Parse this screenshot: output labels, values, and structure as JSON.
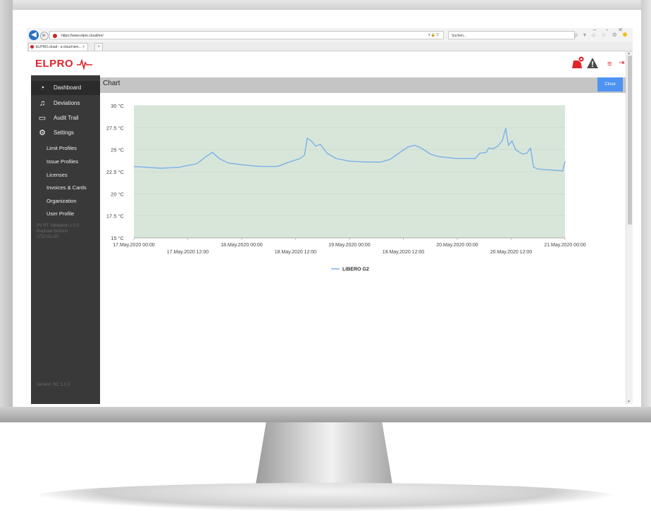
{
  "browser": {
    "url": "https://www.elpro.cloud/en/",
    "search_placeholder": "Suchen...",
    "tab_title": "ELPRO.cloud - a cloud tem...",
    "new_tab": "+",
    "window_controls": "–  ▫  ✕",
    "toolbar_icons": "ρ ▾  ⌂ ☆ ⚙",
    "addr_tools": "▾ 🔒 C"
  },
  "app": {
    "logo_text": "ELPRO",
    "brand_color": "#e0242c",
    "accent_color": "#4e93f3"
  },
  "header_icons": {
    "bell": "bell-icon",
    "warning": "warning-icon",
    "menu": "≡",
    "logout": "⇥"
  },
  "sidebar": {
    "main_items": [
      {
        "label": "Dashboard",
        "icon": "dashboard-icon",
        "glyph": "◔"
      },
      {
        "label": "Deviations",
        "icon": "bell-icon",
        "glyph": "🔔"
      },
      {
        "label": "Audit Trail",
        "icon": "audit-icon",
        "glyph": "🗎"
      },
      {
        "label": "Settings",
        "icon": "gear-icon",
        "glyph": "⚙"
      }
    ],
    "sub_items": [
      "Limit Profiles",
      "Issue Profiles",
      "Licenses",
      "Invoices & Cards",
      "Organization",
      "User Profile"
    ],
    "info_lines": [
      "PV RT Validation 1.0.0",
      "Raphael Burtsch",
      "UTC+01:00"
    ],
    "version": "Version: RC 1.0.0"
  },
  "chart_panel": {
    "title": "Chart",
    "close_label": "Close"
  },
  "chart_data": {
    "type": "line",
    "title": "",
    "xlabel": "",
    "ylabel": "",
    "y_ticks": [
      "15 °C",
      "17.5 °C",
      "20 °C",
      "22.5 °C",
      "25 °C",
      "27.5 °C",
      "30 °C"
    ],
    "ylim": [
      15,
      30
    ],
    "x_ticks_upper": [
      "17.May.2020 00:00",
      "18.May.2020 00:00",
      "19.May.2020 00:00",
      "20.May.2020 00:00",
      "21.May.2020 00:00"
    ],
    "x_ticks_lower": [
      "17.May.2020 12:00",
      "18.May.2020 12:00",
      "19.May.2020 12:00",
      "20.May.2020 12:00"
    ],
    "x_range_hours": [
      0,
      96
    ],
    "plot_band_color": "#d8e6da",
    "line_color": "#7fb4e6",
    "series": [
      {
        "name": "LIBERO G2",
        "points": [
          [
            0,
            23.1
          ],
          [
            6,
            22.9
          ],
          [
            10,
            23.0
          ],
          [
            14,
            23.4
          ],
          [
            16,
            24.2
          ],
          [
            17.5,
            24.7
          ],
          [
            19,
            24.0
          ],
          [
            21,
            23.5
          ],
          [
            24,
            23.3
          ],
          [
            28,
            23.1
          ],
          [
            32,
            23.1
          ],
          [
            34,
            23.5
          ],
          [
            37,
            24.0
          ],
          [
            38,
            24.4
          ],
          [
            38.6,
            26.3
          ],
          [
            39.5,
            26.0
          ],
          [
            40.5,
            25.4
          ],
          [
            41.5,
            25.6
          ],
          [
            43,
            24.6
          ],
          [
            45,
            24.0
          ],
          [
            48,
            23.7
          ],
          [
            52,
            23.6
          ],
          [
            55,
            23.6
          ],
          [
            57,
            23.9
          ],
          [
            59,
            24.6
          ],
          [
            61,
            25.3
          ],
          [
            62.5,
            25.5
          ],
          [
            64,
            25.2
          ],
          [
            66,
            24.5
          ],
          [
            68,
            24.2
          ],
          [
            72,
            24.0
          ],
          [
            76,
            24.0
          ],
          [
            77,
            24.6
          ],
          [
            78.5,
            24.7
          ],
          [
            79,
            25.2
          ],
          [
            80,
            25.1
          ],
          [
            81,
            25.4
          ],
          [
            82,
            26.0
          ],
          [
            82.8,
            27.4
          ],
          [
            83.4,
            25.5
          ],
          [
            84.2,
            26.0
          ],
          [
            85,
            25.0
          ],
          [
            86.5,
            24.5
          ],
          [
            87.5,
            24.6
          ],
          [
            88.3,
            25.2
          ],
          [
            89,
            23.0
          ],
          [
            90,
            22.8
          ],
          [
            93,
            22.7
          ],
          [
            95.5,
            22.6
          ],
          [
            96,
            23.7
          ]
        ]
      }
    ],
    "legend_position": "bottom-center"
  }
}
